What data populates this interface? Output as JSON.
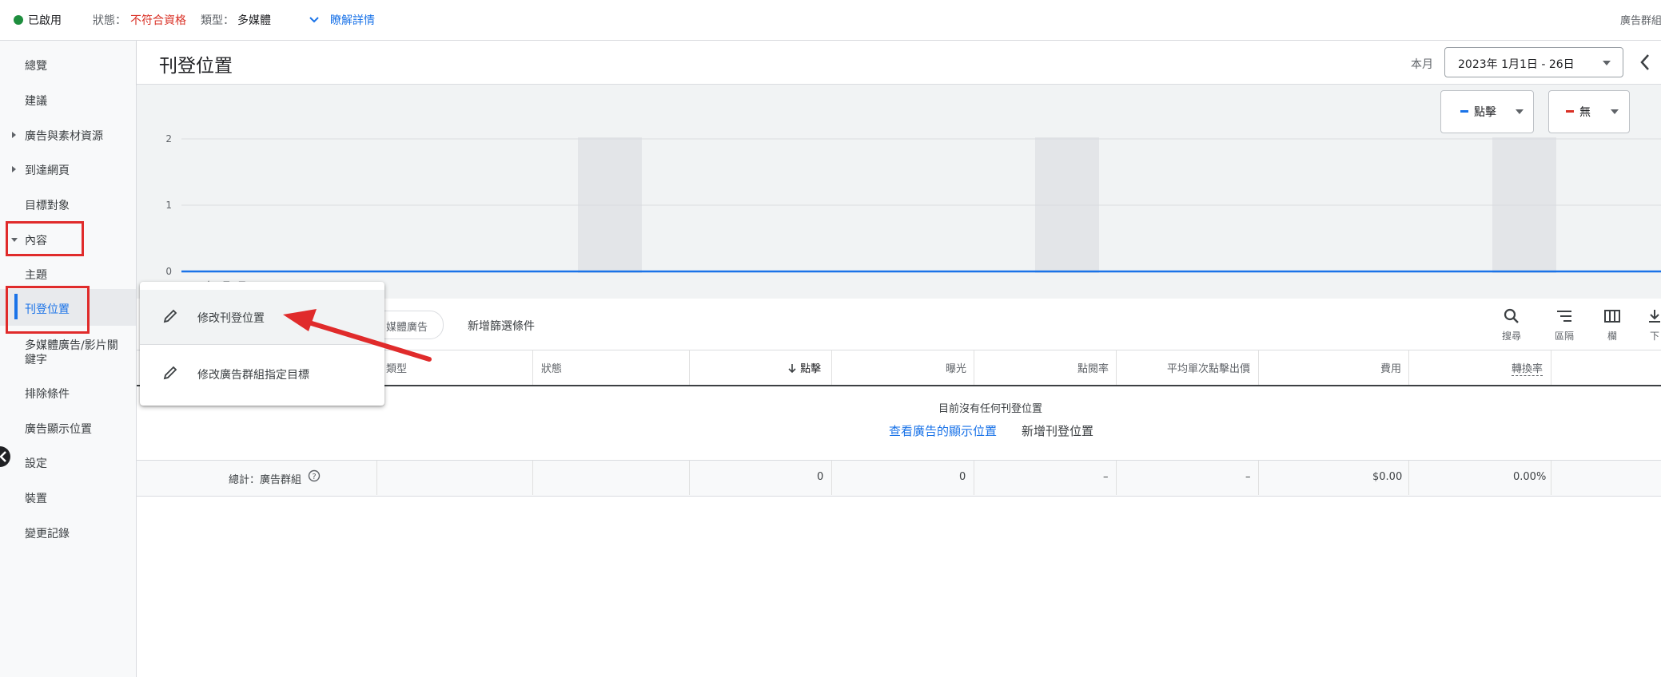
{
  "status_bar": {
    "enabled_label": "已啟用",
    "status_prefix": "狀態：",
    "status_value": "不符合資格",
    "type_prefix": "類型：",
    "type_value": "多媒體",
    "details_link": "瞭解詳情",
    "right_label": "廣告群組"
  },
  "sidebar": {
    "items": [
      {
        "label": "總覽"
      },
      {
        "label": "建議"
      },
      {
        "label": "廣告與素材資源"
      },
      {
        "label": "到達網頁"
      },
      {
        "label": "目標對象"
      },
      {
        "label": "內容"
      },
      {
        "label": "主題"
      },
      {
        "label": "刊登位置"
      },
      {
        "label": "多媒體廣告/影片關鍵字"
      },
      {
        "label": "排除條件"
      },
      {
        "label": "廣告顯示位置"
      },
      {
        "label": "設定"
      },
      {
        "label": "裝置"
      },
      {
        "label": "變更記錄"
      }
    ]
  },
  "header": {
    "title": "刊登位置",
    "period_label": "本月",
    "date_range": "2023年 1月1日 - 26日"
  },
  "chart": {
    "legend": [
      {
        "label": "點擊",
        "color": "#1a73e8"
      },
      {
        "label": "無",
        "color": "#d93025"
      }
    ],
    "y_ticks": [
      "2",
      "1",
      "0"
    ],
    "x_first_label": "2023年1月1日"
  },
  "chart_data": {
    "type": "line",
    "series": [
      {
        "name": "點擊",
        "values": [
          0,
          0,
          0,
          0,
          0,
          0,
          0,
          0,
          0,
          0,
          0,
          0,
          0,
          0,
          0,
          0,
          0,
          0,
          0,
          0,
          0,
          0,
          0,
          0,
          0,
          0
        ]
      }
    ],
    "ylim": [
      0,
      2
    ],
    "title": "",
    "xlabel": "",
    "ylabel": ""
  },
  "filter_bar": {
    "chip_partial": "媒體廣告",
    "add_filter": "新增篩選條件"
  },
  "toolbar": {
    "search": "搜尋",
    "segment": "區隔",
    "columns": "欄",
    "download_partial": "下"
  },
  "table": {
    "columns": [
      "類型",
      "狀態",
      "點擊",
      "曝光",
      "點閱率",
      "平均單次點擊出價",
      "費用",
      "轉換率"
    ],
    "empty_message": "目前沒有任何刊登位置",
    "view_link": "查看廣告的顯示位置",
    "add_link": "新增刊登位置",
    "total_label": "總計：廣告群組",
    "totals": [
      "0",
      "0",
      "–",
      "–",
      "$0.00",
      "0.00%"
    ]
  },
  "popup": {
    "items": [
      {
        "label": "修改刊登位置"
      },
      {
        "label": "修改廣告群組指定目標"
      }
    ]
  }
}
